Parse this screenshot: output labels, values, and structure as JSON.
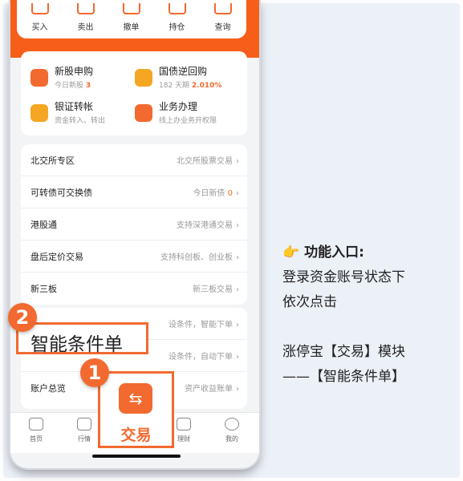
{
  "top_actions": [
    {
      "label": "买入",
      "icon": "buy-icon"
    },
    {
      "label": "卖出",
      "icon": "sell-icon"
    },
    {
      "label": "撤单",
      "icon": "cancel-order-icon"
    },
    {
      "label": "持仓",
      "icon": "holdings-icon"
    },
    {
      "label": "查询",
      "icon": "query-icon"
    }
  ],
  "features": [
    {
      "title": "新股申购",
      "sub_prefix": "今日新股 ",
      "sub_highlight": "3",
      "icon": "ipo-icon",
      "color": "#f26a2f"
    },
    {
      "title": "国债逆回购",
      "sub_prefix": "182 天期 ",
      "sub_highlight": "2.010%",
      "icon": "bond-repo-icon",
      "color": "#f5a623"
    },
    {
      "title": "银证转帐",
      "sub_prefix": "资金转入、转出",
      "sub_highlight": "",
      "icon": "bank-transfer-icon",
      "color": "#f5a623"
    },
    {
      "title": "业务办理",
      "sub_prefix": "线上办业务开权限",
      "sub_highlight": "",
      "icon": "business-icon",
      "color": "#f26a2f"
    }
  ],
  "menu_rows": [
    {
      "label": "北交所专区",
      "right": "北交所股票交易",
      "badge": ""
    },
    {
      "label": "可转债可交换债",
      "right": "今日新债 ",
      "badge": "0"
    },
    {
      "label": "港股通",
      "right": "支持深港通交易",
      "badge": ""
    },
    {
      "label": "盘后定价交易",
      "right": "支持科创板、创业板",
      "badge": ""
    },
    {
      "label": "新三板",
      "right": "新三板交易",
      "badge": ""
    }
  ],
  "menu_rows_2": [
    {
      "label": "",
      "right": "设条件，智能下单",
      "badge": ""
    },
    {
      "label": "",
      "right": "设条件，自动下单",
      "badge": ""
    },
    {
      "label": "账户总览",
      "right": "资产收益账单",
      "badge": ""
    }
  ],
  "tabs": [
    {
      "label": "首页",
      "icon": "home-icon"
    },
    {
      "label": "行情",
      "icon": "market-icon"
    },
    {
      "label": "交易",
      "icon": "trade-icon"
    },
    {
      "label": "理财",
      "icon": "wealth-icon"
    },
    {
      "label": "我的",
      "icon": "profile-icon"
    }
  ],
  "callouts": {
    "step1_number": "1",
    "step1_label": "交易",
    "step1_icon": "⇆",
    "step2_number": "2",
    "step2_label": "智能条件单"
  },
  "side_note": {
    "hand": "👉",
    "heading": "功能入口:",
    "line1": "登录资金账号状态下",
    "line2": "依次点击",
    "line3": "涨停宝【交易】模块",
    "line4": "——【智能条件单】"
  },
  "colors": {
    "accent": "#f26a2f",
    "band": "#f65e1a"
  }
}
